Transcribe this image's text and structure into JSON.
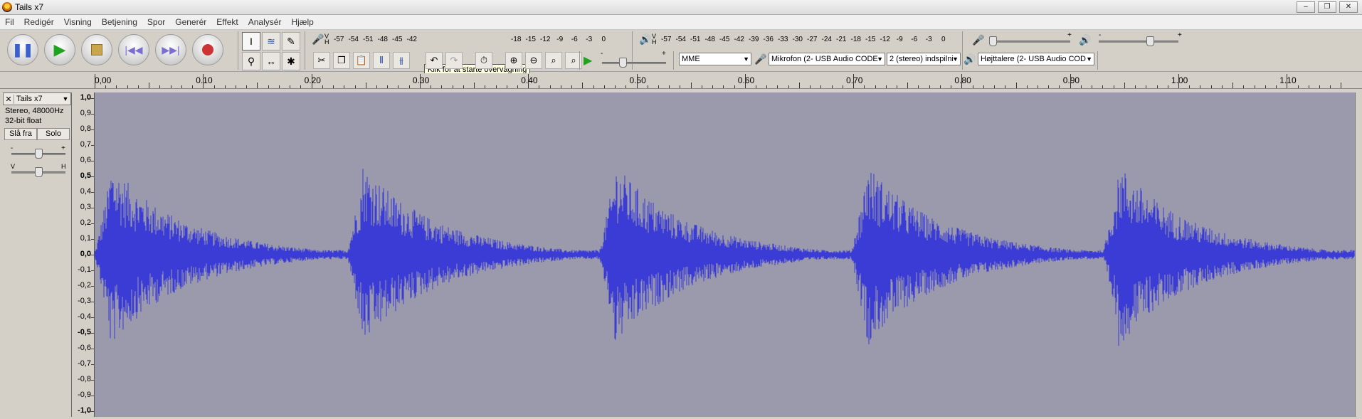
{
  "window": {
    "title": "Tails x7",
    "buttons": [
      "–",
      "❐",
      "✕"
    ]
  },
  "menu": [
    "Fil",
    "Redigér",
    "Visning",
    "Betjening",
    "Spor",
    "Generér",
    "Effekt",
    "Analysér",
    "Hjælp"
  ],
  "record_meter": {
    "scale": [
      "-57",
      "-54",
      "-51",
      "-48",
      "-45",
      "-42",
      "-18",
      "-15",
      "-12",
      "-9",
      "-6",
      "-3",
      "0"
    ],
    "tooltip": "Klik for at starte overvågning"
  },
  "play_meter": {
    "scale": [
      "-57",
      "-54",
      "-51",
      "-48",
      "-45",
      "-42",
      "-39",
      "-36",
      "-33",
      "-30",
      "-27",
      "-24",
      "-21",
      "-18",
      "-15",
      "-12",
      "-9",
      "-6",
      "-3",
      "0"
    ]
  },
  "mixer": {
    "minus": "-",
    "plus": "+"
  },
  "device": {
    "host": "MME",
    "input": "Mikrofon (2- USB Audio CODE",
    "channels": "2 (stereo) indspilni",
    "output": "Højttalere (2- USB Audio COD"
  },
  "ruler": [
    "0,00",
    "0.10",
    "0.20",
    "0.30",
    "0.40",
    "0.50",
    "0.60",
    "0.70",
    "0.80",
    "0.90",
    "1.00",
    "1.10"
  ],
  "track": {
    "name": "Tails x7",
    "format": "Stereo, 48000Hz",
    "bit_depth": "32-bit float",
    "mute_label": "Slå fra",
    "solo_label": "Solo",
    "gain_minus": "-",
    "gain_plus": "+",
    "pan_left": "V",
    "pan_right": "H"
  },
  "vruler": [
    "1,0",
    "0,9",
    "0,8",
    "0,7",
    "0,6",
    "0,5",
    "0,4",
    "0,3",
    "0,2",
    "0,1",
    "0,0",
    "-0,1",
    "-0,2",
    "-0,3",
    "-0,4",
    "-0,5",
    "-0,6",
    "-0,7",
    "-0,8",
    "-0,9",
    "-1,0"
  ],
  "waveform": {
    "bursts": [
      0.0,
      0.2,
      0.4,
      0.6,
      0.8
    ],
    "color": "#3b3bd6",
    "background": "#9a9aac"
  }
}
